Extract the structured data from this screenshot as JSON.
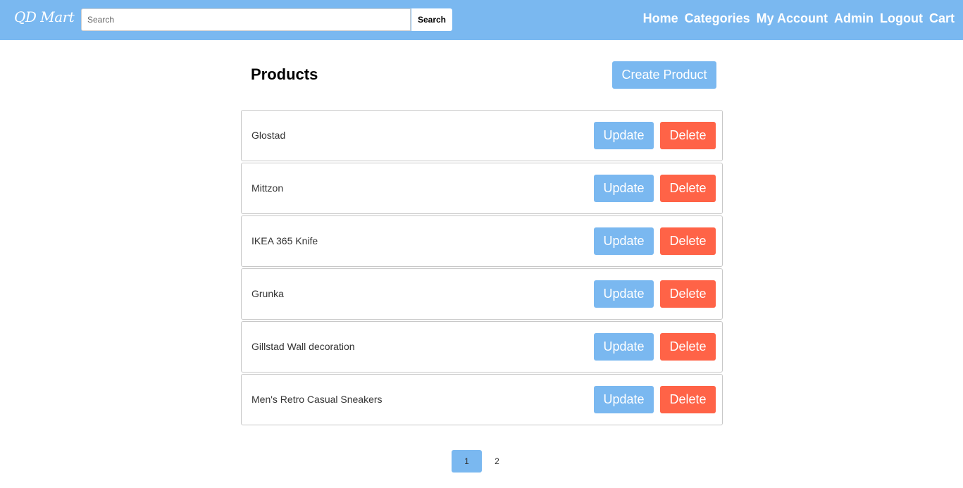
{
  "navbar": {
    "brand": "QD Mart",
    "search": {
      "placeholder": "Search",
      "value": "",
      "button_label": "Search"
    },
    "links": [
      "Home",
      "Categories",
      "My Account",
      "Admin",
      "Logout",
      "Cart"
    ]
  },
  "main": {
    "title": "Products",
    "create_button_label": "Create Product",
    "products": [
      {
        "name": "Glostad",
        "update_label": "Update",
        "delete_label": "Delete"
      },
      {
        "name": "Mittzon",
        "update_label": "Update",
        "delete_label": "Delete"
      },
      {
        "name": "IKEA 365 Knife",
        "update_label": "Update",
        "delete_label": "Delete"
      },
      {
        "name": "Grunka",
        "update_label": "Update",
        "delete_label": "Delete"
      },
      {
        "name": "Gillstad Wall decoration",
        "update_label": "Update",
        "delete_label": "Delete"
      },
      {
        "name": "Men's Retro Casual Sneakers",
        "update_label": "Update",
        "delete_label": "Delete"
      }
    ]
  },
  "pagination": {
    "pages": [
      "1",
      "2"
    ],
    "current": "1"
  },
  "colors": {
    "primary": "#7ab8f0",
    "danger": "#ff6347",
    "border": "#c8c8c8"
  }
}
